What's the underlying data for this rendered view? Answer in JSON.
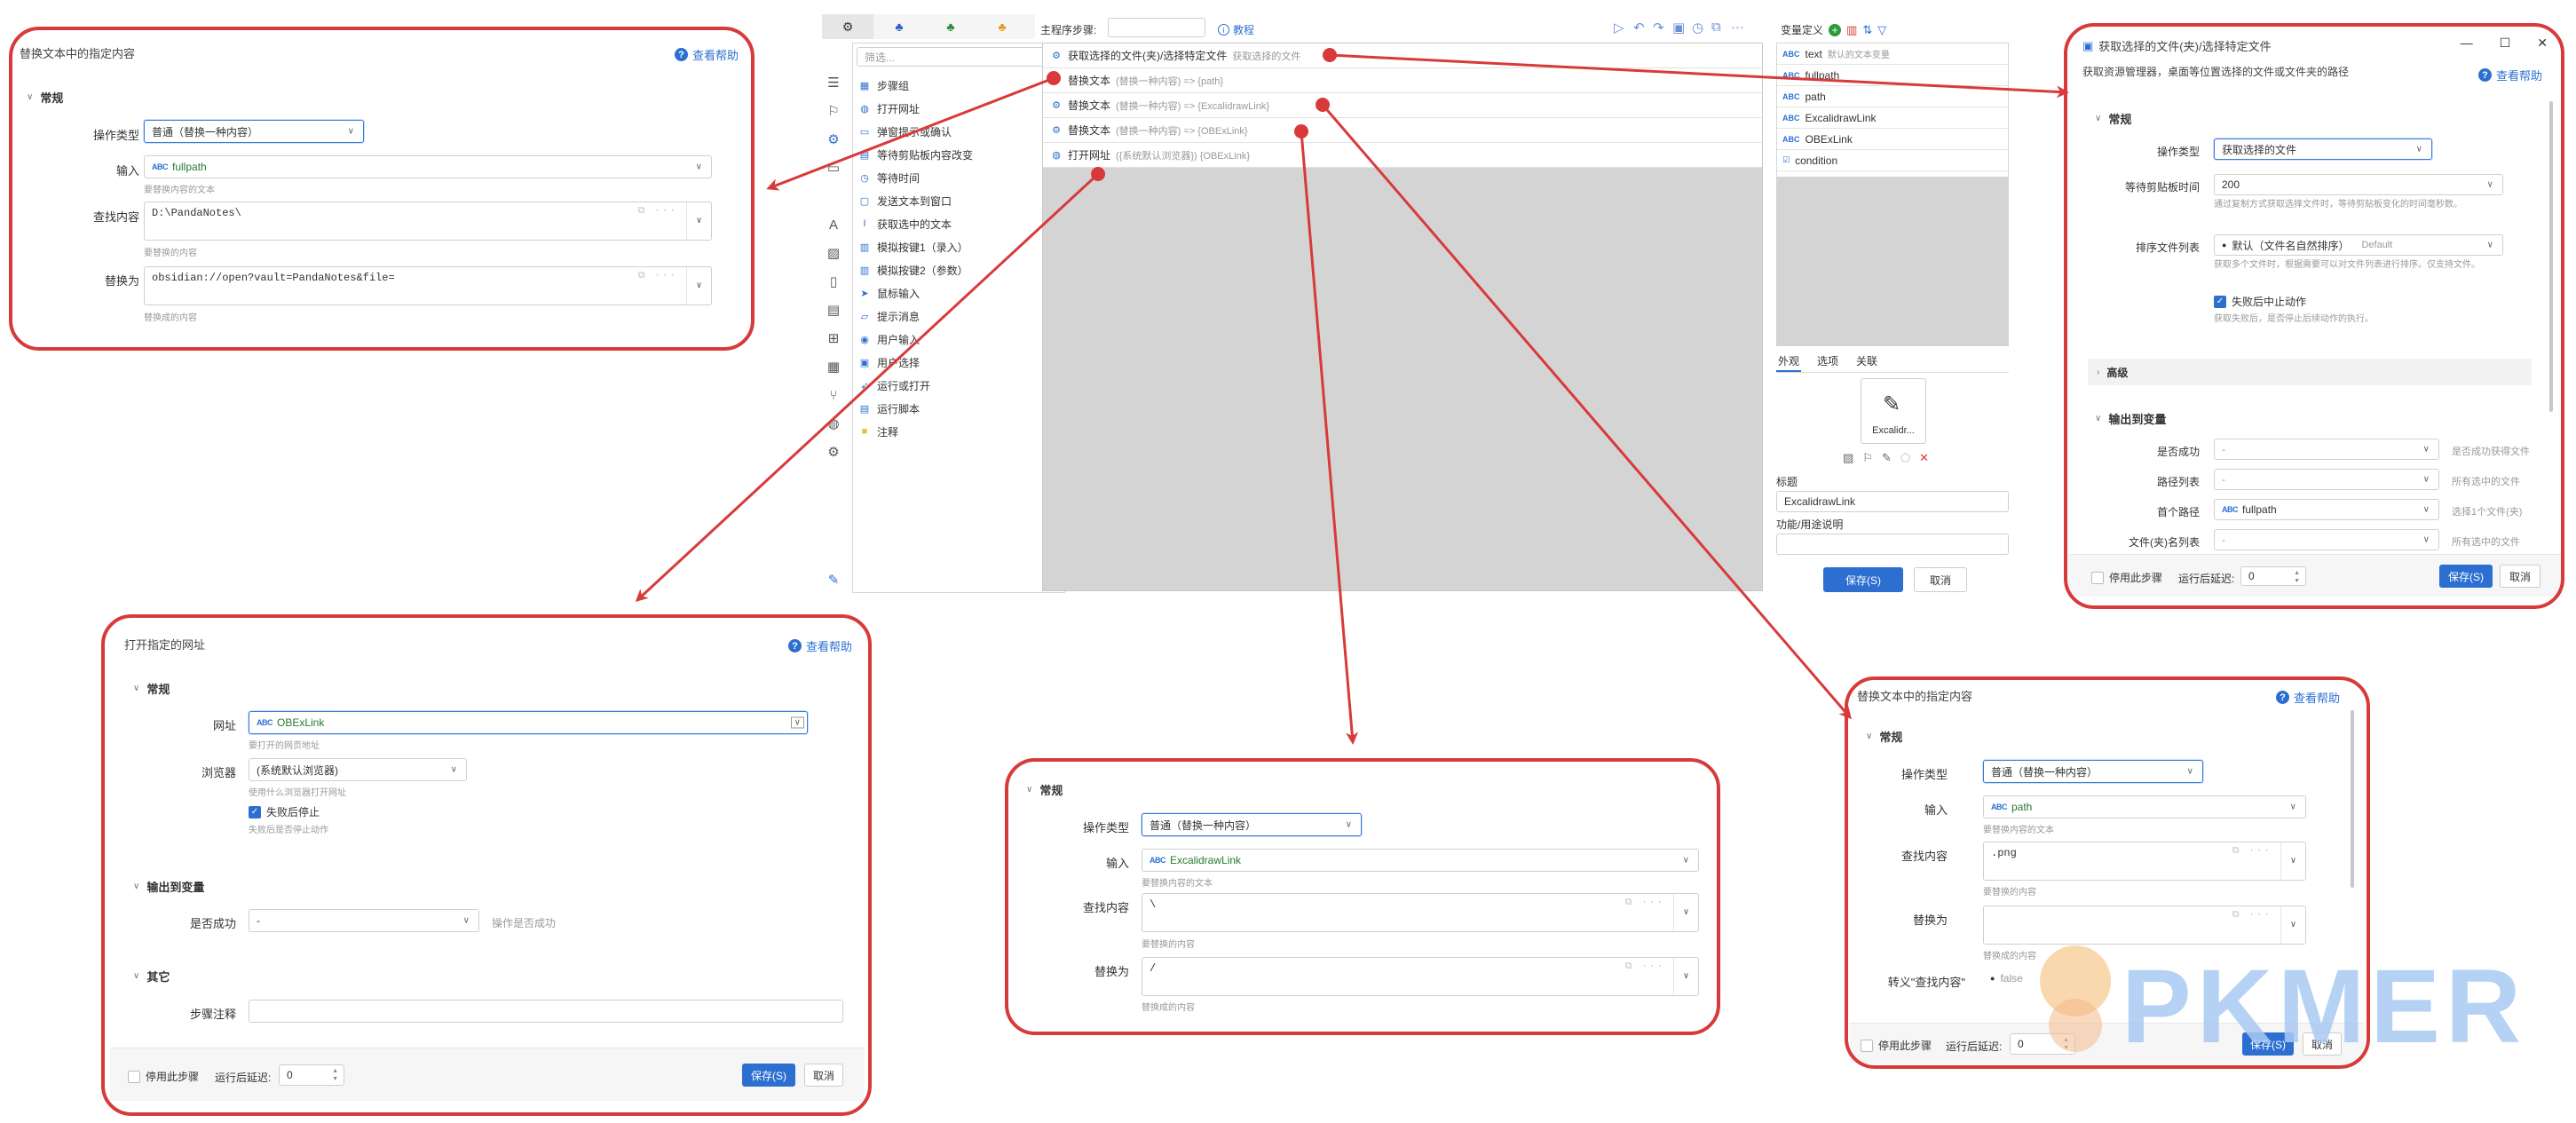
{
  "panel_replace1": {
    "title": "替换文本中的指定内容",
    "help": "查看帮助",
    "section": "常规",
    "op_label": "操作类型",
    "op_value": "普通（替换一种内容）",
    "input_label": "输入",
    "input_value": "fullpath",
    "input_hint": "要替换内容的文本",
    "find_label": "查找内容",
    "find_value": "D:\\PandaNotes\\",
    "find_hint": "要替换的内容",
    "replace_label": "替换为",
    "replace_value": "obsidian://open?vault=PandaNotes&file=",
    "replace_hint": "替换成的内容"
  },
  "main": {
    "tabs": [
      "⚙",
      "♣",
      "♣",
      "♣"
    ],
    "main_steps_label": "主程序步骤:",
    "tutorial": "教程",
    "filter_placeholder": "筛选...",
    "actions": [
      {
        "icon": "layers-icon",
        "glyph": "▦",
        "label": "步骤组"
      },
      {
        "icon": "globe-icon",
        "glyph": "◍",
        "label": "打开网址"
      },
      {
        "icon": "window-icon",
        "glyph": "▭",
        "label": "弹窗提示或确认"
      },
      {
        "icon": "clipboard-icon",
        "glyph": "▤",
        "label": "等待剪贴板内容改变"
      },
      {
        "icon": "clock-icon",
        "glyph": "◷",
        "label": "等待时间"
      },
      {
        "icon": "message-icon",
        "glyph": "▢",
        "label": "发送文本到窗口"
      },
      {
        "icon": "text-cursor-icon",
        "glyph": "I",
        "label": "获取选中的文本"
      },
      {
        "icon": "keyboard-icon",
        "glyph": "▥",
        "label": "模拟按键1（录入）"
      },
      {
        "icon": "keyboard-icon",
        "glyph": "▥",
        "label": "模拟按键2（参数）"
      },
      {
        "icon": "cursor-icon",
        "glyph": "➤",
        "label": "鼠标输入"
      },
      {
        "icon": "chat-icon",
        "glyph": "▱",
        "label": "提示消息"
      },
      {
        "icon": "user-icon",
        "glyph": "◉",
        "label": "用户输入"
      },
      {
        "icon": "user-select-icon",
        "glyph": "▣",
        "label": "用户选择"
      },
      {
        "icon": "send-icon",
        "glyph": "➶",
        "label": "运行或打开"
      },
      {
        "icon": "code-icon",
        "glyph": "▤",
        "label": "运行脚本"
      },
      {
        "icon": "note-icon",
        "glyph": "■",
        "label": "注释"
      }
    ],
    "steps": [
      {
        "name": "获取选择的文件(夹)/选择特定文件",
        "sub": "获取选择的文件"
      },
      {
        "name": "替换文本",
        "sub": "(替换一种内容) => {path}"
      },
      {
        "name": "替换文本",
        "sub": "(替换一种内容) => {ExcalidrawLink}"
      },
      {
        "name": "替换文本",
        "sub": "(替换一种内容) => {OBExLink}"
      },
      {
        "name": "打开网址",
        "sub": "({系统默认浏览器}) {OBExLink}"
      }
    ],
    "var_title": "变量定义",
    "vars": [
      {
        "type": "ABC",
        "name": "text",
        "sub": "默认的文本变量"
      },
      {
        "type": "ABC",
        "name": "fullpath",
        "sub": ""
      },
      {
        "type": "ABC",
        "name": "path",
        "sub": ""
      },
      {
        "type": "ABC",
        "name": "ExcalidrawLink",
        "sub": ""
      },
      {
        "type": "ABC",
        "name": "OBExLink",
        "sub": ""
      },
      {
        "type": "☑",
        "name": "condition",
        "sub": ""
      }
    ],
    "prop_tabs": [
      "外观",
      "选项",
      "关联"
    ],
    "icon_caption": "Excalidr...",
    "title_label": "标题",
    "title_value": "ExcalidrawLink",
    "desc_label": "功能/用途说明",
    "save": "保存(S)",
    "cancel": "取消"
  },
  "panel_getfile": {
    "title": "获取选择的文件(夹)/选择特定文件",
    "subtitle": "获取资源管理器，桌面等位置选择的文件或文件夹的路径",
    "help": "查看帮助",
    "section": "常规",
    "op_label": "操作类型",
    "op_value": "获取选择的文件",
    "wait_label": "等待剪贴板时间",
    "wait_value": "200",
    "wait_hint": "通过复制方式获取选择文件时，等待剪贴板变化的时间毫秒数。",
    "sort_label": "排序文件列表",
    "sort_value": "默认（文件名自然排序）",
    "sort_default": "Default",
    "sort_hint": "获取多个文件时，根据需要可以对文件列表进行排序。仅支持文件。",
    "stop_label": "失败后中止动作",
    "stop_hint": "获取失败后，是否停止后续动作的执行。",
    "advanced": "高级",
    "output_section": "输出到变量",
    "out_rows": [
      {
        "label": "是否成功",
        "value": "-",
        "hint": "是否成功获得文件"
      },
      {
        "label": "路径列表",
        "value": "-",
        "hint": "所有选中的文件"
      },
      {
        "label": "首个路径",
        "value": "fullpath",
        "hint": "选择1个文件(夹)"
      },
      {
        "label": "文件(夹)名列表",
        "value": "-",
        "hint": "所有选中的文件"
      }
    ],
    "disable_label": "停用此步骤",
    "delay_label": "运行后延迟:",
    "delay_value": "0",
    "save": "保存(S)",
    "cancel": "取消"
  },
  "panel_openurl": {
    "title": "打开指定的网址",
    "help": "查看帮助",
    "section": "常规",
    "url_label": "网址",
    "url_value": "OBExLink",
    "url_hint": "要打开的网页地址",
    "browser_label": "浏览器",
    "browser_value": "(系统默认浏览器)",
    "browser_hint": "使用什么浏览器打开网址",
    "stop_label": "失败后停止",
    "stop_hint": "失败后是否停止动作",
    "output_section": "输出到变量",
    "success_label": "是否成功",
    "success_value": "-",
    "success_hint": "操作是否成功",
    "other_section": "其它",
    "note_label": "步骤注释",
    "disable_label": "停用此步骤",
    "delay_label": "运行后延迟:",
    "delay_value": "0",
    "save": "保存(S)",
    "cancel": "取消"
  },
  "panel_replace2": {
    "section": "常规",
    "op_label": "操作类型",
    "op_value": "普通（替换一种内容）",
    "input_label": "输入",
    "input_value": "ExcalidrawLink",
    "input_hint": "要替换内容的文本",
    "find_label": "查找内容",
    "find_value": "\\",
    "find_hint": "要替换的内容",
    "replace_label": "替换为",
    "replace_value": "/",
    "replace_hint": "替换成的内容"
  },
  "panel_replace3": {
    "title": "替换文本中的指定内容",
    "help": "查看帮助",
    "section": "常规",
    "op_label": "操作类型",
    "op_value": "普通（替换一种内容）",
    "input_label": "输入",
    "input_value": "path",
    "input_hint": "要替换内容的文本",
    "find_label": "查找内容",
    "find_value": ".png",
    "find_hint": "要替换的内容",
    "replace_label": "替换为",
    "replace_value": "",
    "replace_hint": "替换成的内容",
    "escape_label": "转义\"查找内容\"",
    "escape_value": "false",
    "disable_label": "停用此步骤",
    "delay_label": "运行后延迟:",
    "delay_value": "0",
    "save": "保存(S)",
    "cancel": "取消"
  },
  "watermark": "PKMER"
}
